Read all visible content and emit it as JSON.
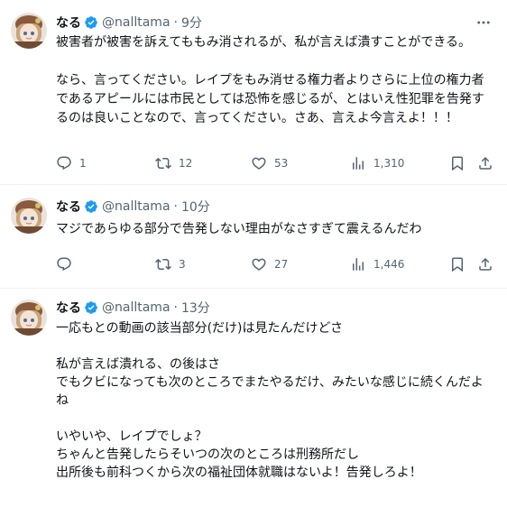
{
  "tweets": [
    {
      "name": "なる",
      "handle": "@nalltama",
      "time": "9分",
      "text": [
        "被害者が被害を訴えてももみ消されるが、私が言えば潰すことができる。",
        "",
        "なら、言ってください。レイプをもみ消せる権力者よりさらに上位の権力者",
        "であるアピールには市民としては恐怖を感じるが、とはいえ性犯罪を告発す",
        "るのは良いことなので、言ってください。さあ、言えよ今言えよ！！！"
      ],
      "replies": "1",
      "retweets": "12",
      "likes": "53",
      "views": "1,310"
    },
    {
      "name": "なる",
      "handle": "@nalltama",
      "time": "10分",
      "text": [
        "マジであらゆる部分で告発しない理由がなさすぎて震えるんだわ"
      ],
      "replies": "",
      "retweets": "3",
      "likes": "27",
      "views": "1,446"
    },
    {
      "name": "なる",
      "handle": "@nalltama",
      "time": "13分",
      "text": [
        "一応もとの動画の該当部分(だけ)は見たんだけどさ",
        "",
        "私が言えば潰れる、の後はさ",
        "でもクビになっても次のところでまたやるだけ、みたいな感じに続くんだよ",
        "ね",
        "",
        "いやいや、レイプでしょ？",
        "ちゃんと告発したらそいつの次のところは刑務所だし",
        "出所後も前科つくから次の福祉団体就職はないよ！告発しろよ！"
      ]
    }
  ],
  "colors": {
    "text": "#0f1419",
    "secondary": "#536471",
    "verified": "#1d9bf0",
    "divider": "#eff3f4"
  },
  "icons": [
    "reply-icon",
    "retweet-icon",
    "like-icon",
    "views-icon",
    "bookmark-icon",
    "share-icon",
    "more-icon",
    "verified-icon"
  ]
}
